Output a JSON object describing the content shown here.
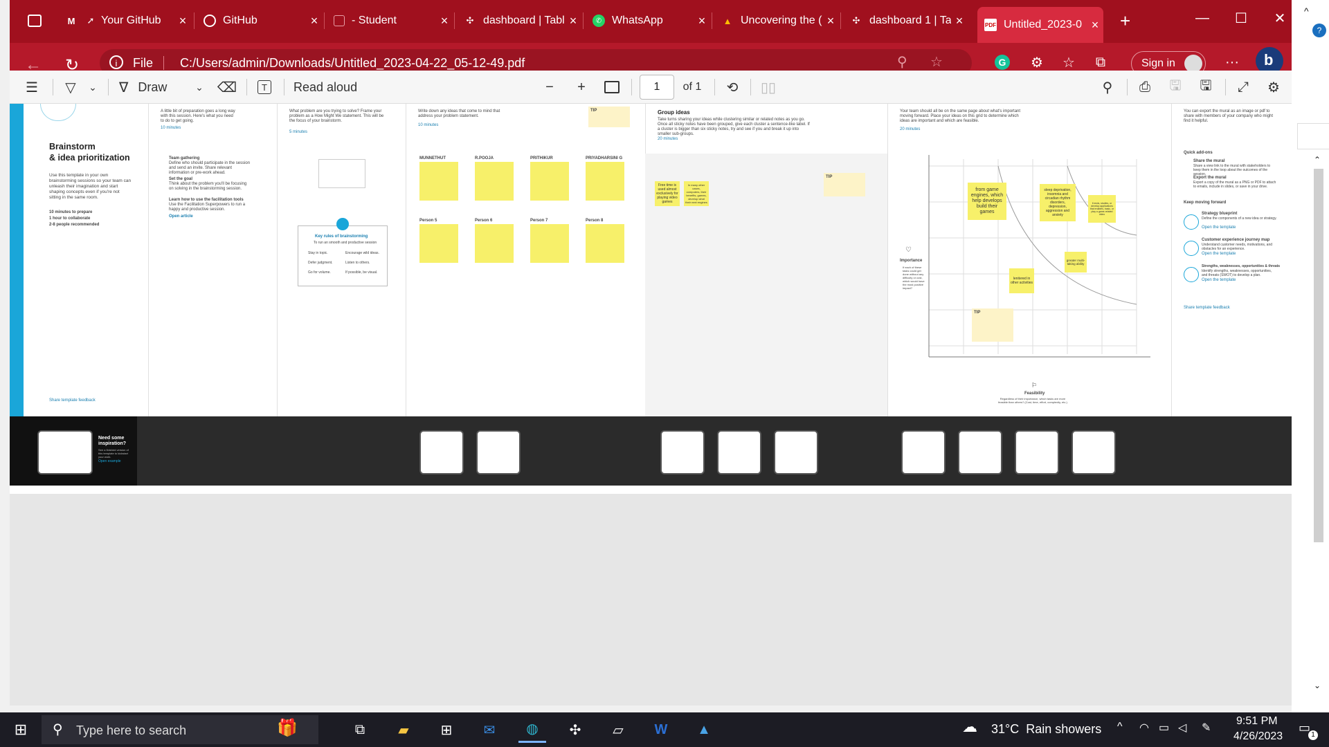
{
  "browser": {
    "tabs": [
      {
        "label": "",
        "icon": "tab-actions-icon"
      },
      {
        "label": "Your GitHub",
        "icon": "gmail-icon"
      },
      {
        "label": "GitHub",
        "icon": "github-icon"
      },
      {
        "label": "- Student",
        "icon": "page-icon"
      },
      {
        "label": "dashboard | Tabl",
        "icon": "tableau-icon"
      },
      {
        "label": "WhatsApp",
        "icon": "whatsapp-icon"
      },
      {
        "label": "Uncovering the (",
        "icon": "drive-icon"
      },
      {
        "label": "dashboard 1 | Ta",
        "icon": "tableau-icon"
      },
      {
        "label": "Untitled_2023-0",
        "icon": "pdf-icon",
        "active": true
      }
    ],
    "new_tab": "+",
    "address": {
      "scheme_label": "File",
      "url": "C:/Users/admin/Downloads/Untitled_2023-04-22_05-12-49.pdf"
    },
    "sign_in": "Sign in",
    "more": "···"
  },
  "pdf_toolbar": {
    "draw": "Draw",
    "read_aloud": "Read aloud",
    "page_current": "1",
    "page_total": "of 1",
    "minus": "−",
    "plus": "+"
  },
  "pdf": {
    "col1": {
      "title": "Brainstorm\n& idea prioritization",
      "desc": "Use this template in your own brainstorming sessions so your team can unleash their imagination and start shaping concepts even if you're not sitting in the same room.",
      "items": [
        "10 minutes to prepare",
        "1 hour to collaborate",
        "2-8 people recommended"
      ],
      "feedback": "Share template feedback"
    },
    "col2": {
      "desc": "A little bit of preparation goes a long way with this session. Here's what you need to do to get going.",
      "time": "10 minutes",
      "steps": [
        {
          "title": "Team gathering",
          "text": "Define who should participate in the session and send an invite. Share relevant information or pre-work ahead."
        },
        {
          "title": "Set the goal",
          "text": "Think about the problem you'll be focusing on solving in the brainstorming session."
        },
        {
          "title": "Learn how to use the facilitation tools",
          "text": "Use the Facilitation Superpowers to run a happy and productive session."
        }
      ],
      "link": "Open article"
    },
    "col3": {
      "desc": "What problem are you trying to solve? Frame your problem as a How Might We statement. This will be the focus of your brainstorm.",
      "time": "5 minutes",
      "rules_title": "Key rules of brainstorming",
      "rules_sub": "To run an smooth and productive session",
      "rules": [
        "Stay in topic.",
        "Encourage wild ideas.",
        "Defer judgment.",
        "Listen to others.",
        "Go for volume.",
        "If possible, be visual."
      ]
    },
    "col4": {
      "desc": "Write down any ideas that come to mind that address your problem statement.",
      "time": "10 minutes",
      "tip": "TIP",
      "persons": [
        "MUNNETHUT",
        "R.POOJA",
        "PRITHIKUR",
        "PRIYADHARSINI G",
        "Person 5",
        "Person 6",
        "Person 7",
        "Person 8"
      ]
    },
    "col5": {
      "title": "Group ideas",
      "desc": "Take turns sharing your ideas while clustering similar or related notes as you go. Once all sticky notes have been grouped, give each cluster a sentence-like label. If a cluster is bigger than six sticky notes, try and see if you and break it up into smaller sub-groups.",
      "time": "20 minutes",
      "stickies": [
        "Free time is used almost exclusively for playing video games",
        "In many other cases, computers, their benefits, games, develop what their next engines"
      ],
      "tip": "TIP"
    },
    "col6": {
      "desc": "Your team should all be on the same page about what's important moving forward. Place your ideas on this grid to determine which ideas are important and which are feasible.",
      "time": "20 minutes",
      "y_label": "Importance",
      "y_desc": "If each of these tasks could get done without any difficulty or cost, which would have the most positive impact?",
      "x_label": "Feasibility",
      "x_desc": "Regardless of their importance, which tasks are more feasible than others? (Cost, time, effort, complexity, etc.)",
      "stickies": [
        "from game engines, which help develops build their games",
        "sleep deprivation, insomnia and circadian rhythm disorders, depression, aggression and anxiety",
        "It ends, studies, or develop applications that enables, basic, or play a game-related video",
        "greater multi-taking ability",
        "lenitered in other activities"
      ],
      "tip": "TIP"
    },
    "col7": {
      "desc": "You can export the mural as an image or pdf to share with members of your company who might find it helpful.",
      "quick": "Quick add-ons",
      "quick_items": [
        {
          "title": "Share the mural",
          "text": "Share a view link to the mural with stakeholders to keep them in the loop about the outcomes of the session."
        },
        {
          "title": "Export the mural",
          "text": "Export a copy of the mural as a PNG or PDF to attach to emails, include in slides, or save in your drive."
        }
      ],
      "keep": "Keep moving forward",
      "keep_items": [
        {
          "title": "Strategy blueprint",
          "text": "Define the components of a new idea or strategy.",
          "link": "Open the template"
        },
        {
          "title": "Customer experience journey map",
          "text": "Understand customer needs, motivations, and obstacles for an experience.",
          "link": "Open the template"
        },
        {
          "title": "Strengths, weaknesses, opportunities & threats",
          "text": "Identify strengths, weaknesses, opportunities, and threats (SWOT) to develop a plan.",
          "link": "Open the template"
        }
      ],
      "feedback": "Share template feedback"
    },
    "band": {
      "need": "Need some inspiration?",
      "need_sub": "See a finished version of this template to kickstart your work.",
      "open": "Open example"
    }
  },
  "taskbar": {
    "search_placeholder": "Type here to search",
    "weather": "31°C  Rain showers",
    "time": "9:51 PM",
    "date": "4/26/2023",
    "notif": "1"
  },
  "colors": {
    "tab_bg": "#a0101e",
    "active_tab": "#d72b3f",
    "address_bg": "#b5192a",
    "sticky": "#f7f06a",
    "accent": "#1aa6d9"
  }
}
